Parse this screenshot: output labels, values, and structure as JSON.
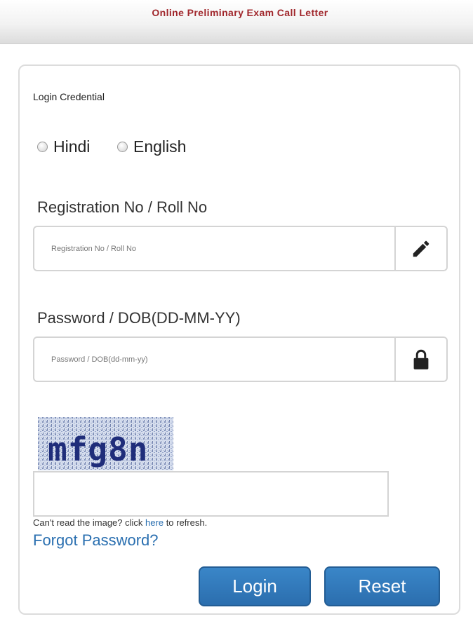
{
  "header": {
    "title": "Online Preliminary Exam Call Letter"
  },
  "form": {
    "section_title": "Login Credential",
    "language_options": [
      {
        "label": "Hindi",
        "selected": false
      },
      {
        "label": "English",
        "selected": false
      }
    ],
    "registration": {
      "label": "Registration No / Roll No",
      "placeholder": "Registration No / Roll No",
      "value": "",
      "icon": "pencil-icon"
    },
    "password": {
      "label": "Password / DOB(DD-MM-YY)",
      "placeholder": "Password / DOB(dd-mm-yy)",
      "value": "",
      "icon": "lock-icon"
    },
    "captcha": {
      "text": "mfg8n",
      "input_value": "",
      "refresh_prefix": "Can't read the image? click",
      "refresh_link": "here",
      "refresh_suffix": "to refresh."
    },
    "forgot_password": "Forgot Password?",
    "login_button": "Login",
    "reset_button": "Reset"
  },
  "colors": {
    "title_red": "#a0262b",
    "link_blue": "#2a6fb0",
    "button_blue": "#2f78bb",
    "captcha_text": "#1f2d7a"
  }
}
